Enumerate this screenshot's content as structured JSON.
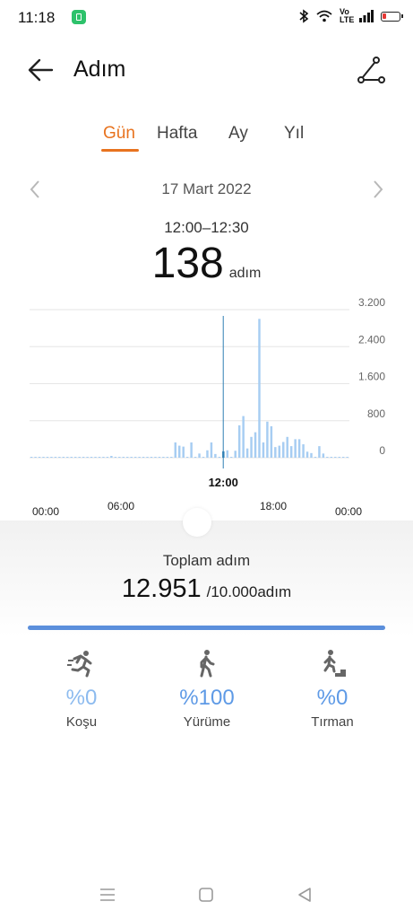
{
  "status_bar": {
    "time": "11:18",
    "network": "Vo LTE"
  },
  "header": {
    "title": "Adım",
    "back_icon": "arrow-left-icon",
    "route_icon": "route-icon"
  },
  "tabs": [
    {
      "label": "Gün",
      "active": true
    },
    {
      "label": "Hafta",
      "active": false
    },
    {
      "label": "Ay",
      "active": false
    },
    {
      "label": "Yıl",
      "active": false
    }
  ],
  "date_nav": {
    "date": "17 Mart 2022",
    "prev_icon": "chevron-left-icon",
    "next_icon": "chevron-right-icon"
  },
  "selection": {
    "range": "12:00–12:30",
    "value": "138",
    "unit": "adım"
  },
  "chart_data": {
    "type": "bar",
    "y_ticks": [
      "3.200",
      "2.400",
      "1.600",
      "800",
      "0"
    ],
    "ylim": [
      0,
      3200
    ],
    "x_ticks": [
      "00:00",
      "06:00",
      "12:00",
      "18:00",
      "00:00"
    ],
    "selected_tick": "12:00",
    "bar_color": "#a7cdf2",
    "selected_color": "#2e7fb4",
    "series": [
      {
        "values": [
          0,
          0,
          0,
          0,
          0,
          0,
          0,
          0,
          0,
          0,
          0,
          0,
          0,
          0,
          0,
          0,
          0,
          0,
          0,
          0,
          30,
          0,
          0,
          0,
          0,
          0,
          0,
          0,
          0,
          0,
          0,
          0,
          0,
          0,
          0,
          0,
          330,
          260,
          240,
          0,
          330,
          0,
          90,
          0,
          160,
          330,
          80,
          0,
          138,
          160,
          0,
          150,
          700,
          900,
          200,
          450,
          550,
          3000,
          330,
          780,
          680,
          230,
          260,
          340,
          450,
          250,
          400,
          400,
          290,
          130,
          100,
          0,
          250,
          90,
          0,
          0,
          0,
          0,
          0,
          0
        ]
      }
    ]
  },
  "summary": {
    "total_label": "Toplam adım",
    "total": "12.951",
    "goal": "/10.000adım",
    "progress": 1.0
  },
  "activities": [
    {
      "icon": "running-icon",
      "percent": "%0",
      "label": "Koşu"
    },
    {
      "icon": "walking-icon",
      "percent": "%100",
      "label": "Yürüme"
    },
    {
      "icon": "climbing-icon",
      "percent": "%0",
      "label": "Tırman"
    }
  ],
  "nav_bar": {
    "menu_icon": "menu-icon",
    "home_icon": "home-icon",
    "back_icon": "triangle-back-icon"
  }
}
